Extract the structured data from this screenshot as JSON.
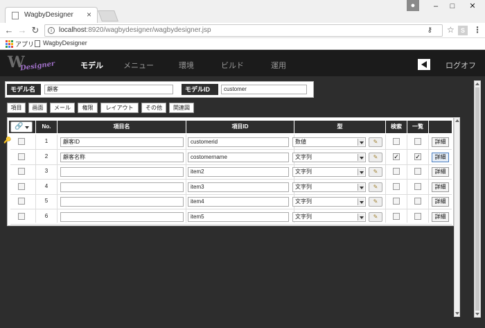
{
  "browser": {
    "tab_title": "WagbyDesigner",
    "tab_close": "×",
    "user_icon": "person-icon",
    "window_controls": [
      "–",
      "□",
      "✕"
    ],
    "url_host": "localhost",
    "url_path": ":8920/wagbydesigner/wagbydesigner.jsp",
    "nav_back": "←",
    "nav_forward": "→",
    "reload": "C",
    "extension_label": "S",
    "menu": "⋮",
    "bookmarks": {
      "apps_label": "アプリ",
      "page_label": "WagbyDesigner",
      "apps_colors": [
        "#e64a3c",
        "#f5b400",
        "#2e9c4e",
        "#4285f4",
        "#e64a3c",
        "#f5b400",
        "#2e9c4e",
        "#4285f4",
        "#e64a3c"
      ]
    }
  },
  "app": {
    "logo_letter": "W",
    "logo_script": "Designer",
    "nav": [
      "モデル",
      "メニュー",
      "環境",
      "ビルド",
      "運用"
    ],
    "logout_label": "ログオフ"
  },
  "model": {
    "name_label": "モデル名",
    "name_value": "顧客",
    "id_label": "モデルID",
    "id_value": "customer"
  },
  "subtabs": [
    "項目",
    "画面",
    "メール",
    "権限",
    "レイアウト",
    "その他",
    "関連図"
  ],
  "table": {
    "headers": {
      "no": "No.",
      "name": "項目名",
      "id": "項目ID",
      "type": "型",
      "search": "検索",
      "list": "一覧"
    },
    "detail_label": "詳細",
    "edit_icon": "pencil-icon",
    "rows": [
      {
        "no": "1",
        "name": "顧客ID",
        "id": "customerid",
        "type": "数値",
        "search": false,
        "list": false,
        "key": true
      },
      {
        "no": "2",
        "name": "顧客名称",
        "id": "costomername",
        "type": "文字列",
        "search": true,
        "list": true,
        "key": false
      },
      {
        "no": "3",
        "name": "",
        "id": "item2",
        "type": "文字列",
        "search": false,
        "list": false,
        "key": false
      },
      {
        "no": "4",
        "name": "",
        "id": "item3",
        "type": "文字列",
        "search": false,
        "list": false,
        "key": false
      },
      {
        "no": "5",
        "name": "",
        "id": "item4",
        "type": "文字列",
        "search": false,
        "list": false,
        "key": false
      },
      {
        "no": "6",
        "name": "",
        "id": "item5",
        "type": "文字列",
        "search": false,
        "list": false,
        "key": false
      }
    ]
  }
}
